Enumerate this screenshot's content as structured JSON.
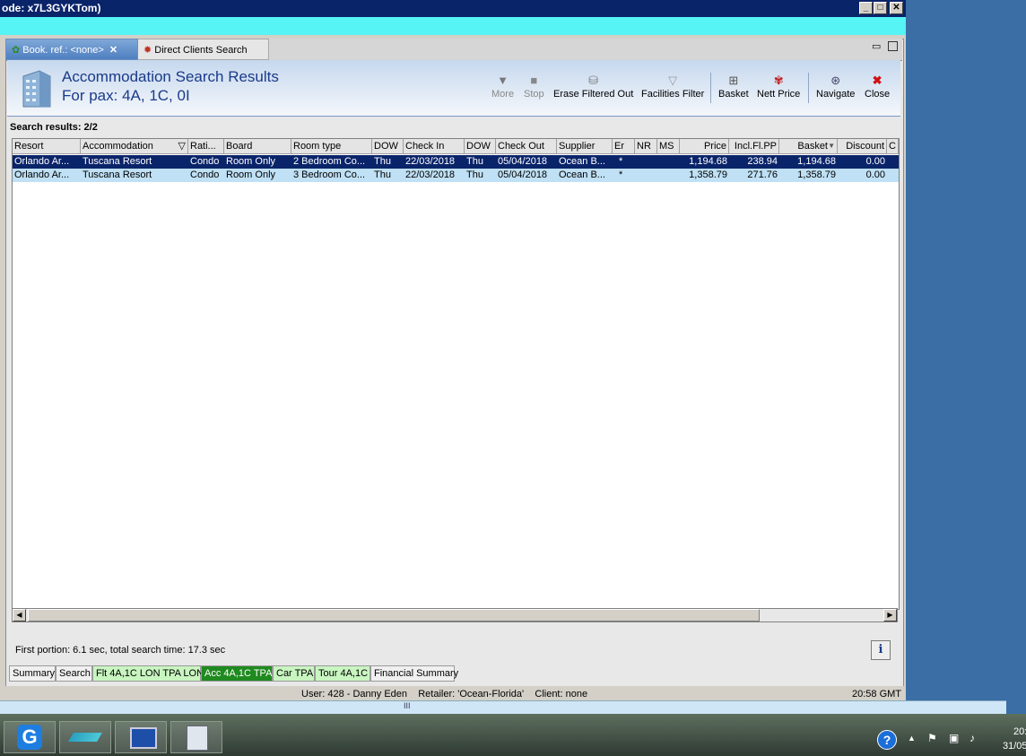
{
  "window": {
    "title": "ode: x7L3GYKTom)",
    "min_label": "_",
    "max_label": "□",
    "close_label": "✕"
  },
  "tabs": [
    {
      "label": "Book. ref.: <none>",
      "close": "✕"
    },
    {
      "label": "Direct Clients Search"
    }
  ],
  "header": {
    "title": "Accommodation Search Results",
    "subtitle": "For pax: 4A, 1C, 0I"
  },
  "toolbar": {
    "more": "More",
    "stop": "Stop",
    "erase": "Erase Filtered Out",
    "facilities": "Facilities Filter",
    "basket": "Basket",
    "nett": "Nett Price",
    "navigate": "Navigate",
    "close": "Close"
  },
  "results_label": "Search results: 2/2",
  "table": {
    "columns": [
      "Resort",
      "Accommodation",
      "Rati...",
      "Board",
      "Room type",
      "DOW",
      "Check In",
      "DOW",
      "Check Out",
      "Supplier",
      "Er",
      "NR",
      "MS",
      "Price",
      "Incl.Fl.PP",
      "Basket",
      "Discount",
      "C"
    ],
    "rows": [
      [
        "Orlando Ar...",
        "Tuscana Resort",
        "Condo",
        "Room Only",
        "2 Bedroom Co...",
        "Thu",
        "22/03/2018",
        "Thu",
        "05/04/2018",
        "Ocean B...",
        "*",
        "",
        "",
        "1,194.68",
        "238.94",
        "1,194.68",
        "0.00",
        ""
      ],
      [
        "Orlando Ar...",
        "Tuscana Resort",
        "Condo",
        "Room Only",
        "3 Bedroom Co...",
        "Thu",
        "22/03/2018",
        "Thu",
        "05/04/2018",
        "Ocean B...",
        "*",
        "",
        "",
        "1,358.79",
        "271.76",
        "1,358.79",
        "0.00",
        ""
      ]
    ]
  },
  "portion_text": "First portion: 6.1 sec, total search time: 17.3 sec",
  "info_label": "i",
  "bottom_tabs": [
    {
      "label": "Summary",
      "color": "#f0f0f0",
      "text": "#000000"
    },
    {
      "label": "Search",
      "color": "#f0f0f0",
      "text": "#000000"
    },
    {
      "label": "Flt 4A,1C LON TPA LON",
      "color": "#c8f5c0",
      "text": "#000000"
    },
    {
      "label": "Acc 4A,1C TPA",
      "color": "#1f8a1f",
      "text": "#ffffff"
    },
    {
      "label": "Car TPA",
      "color": "#c8f5c0",
      "text": "#000000"
    },
    {
      "label": "Tour 4A,1C",
      "color": "#c8f5c0",
      "text": "#000000"
    },
    {
      "label": "Financial Summary",
      "color": "#f0f0f0",
      "text": "#000000"
    }
  ],
  "status": {
    "user": "User: 428 - Danny Eden    Retailer: 'Ocean-Florida'    Client: none",
    "time": "20:58 GMT"
  },
  "splitter_grip": "III",
  "tray": {
    "time": "20:",
    "date": "31/05"
  }
}
